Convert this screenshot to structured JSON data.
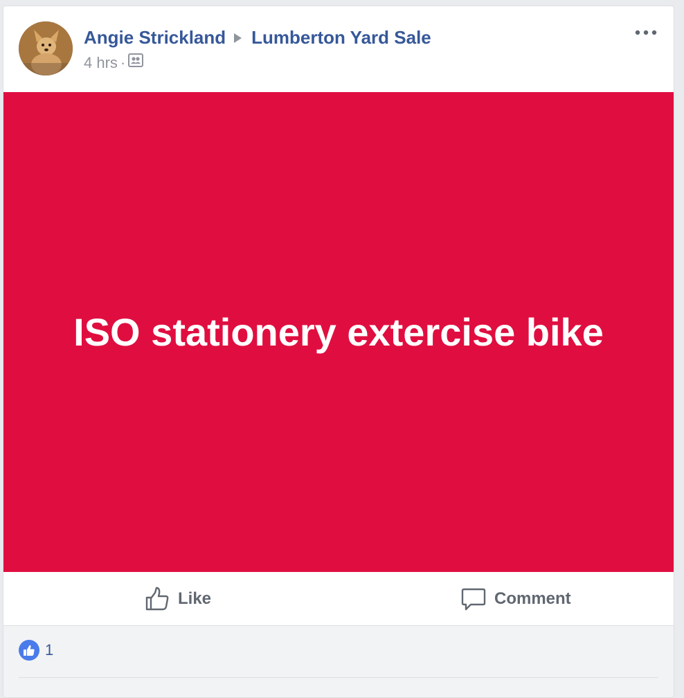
{
  "post": {
    "author": "Angie Strickland",
    "group": "Lumberton Yard Sale",
    "time": "4 hrs",
    "separator": "·",
    "text": "ISO stationery extercise bike",
    "background_color": "#e00e40"
  },
  "actions": {
    "like_label": "Like",
    "comment_label": "Comment"
  },
  "reactions": {
    "count": "1",
    "type": "like"
  },
  "icons": {
    "avatar": "profile-photo",
    "audience": "group-members-icon",
    "more": "more-options-icon",
    "arrow": "triangle-right-icon",
    "like": "thumbs-up-icon",
    "comment": "speech-bubble-icon"
  },
  "colors": {
    "link": "#365899",
    "meta": "#90949c",
    "reaction_blue": "#4a7bea"
  }
}
